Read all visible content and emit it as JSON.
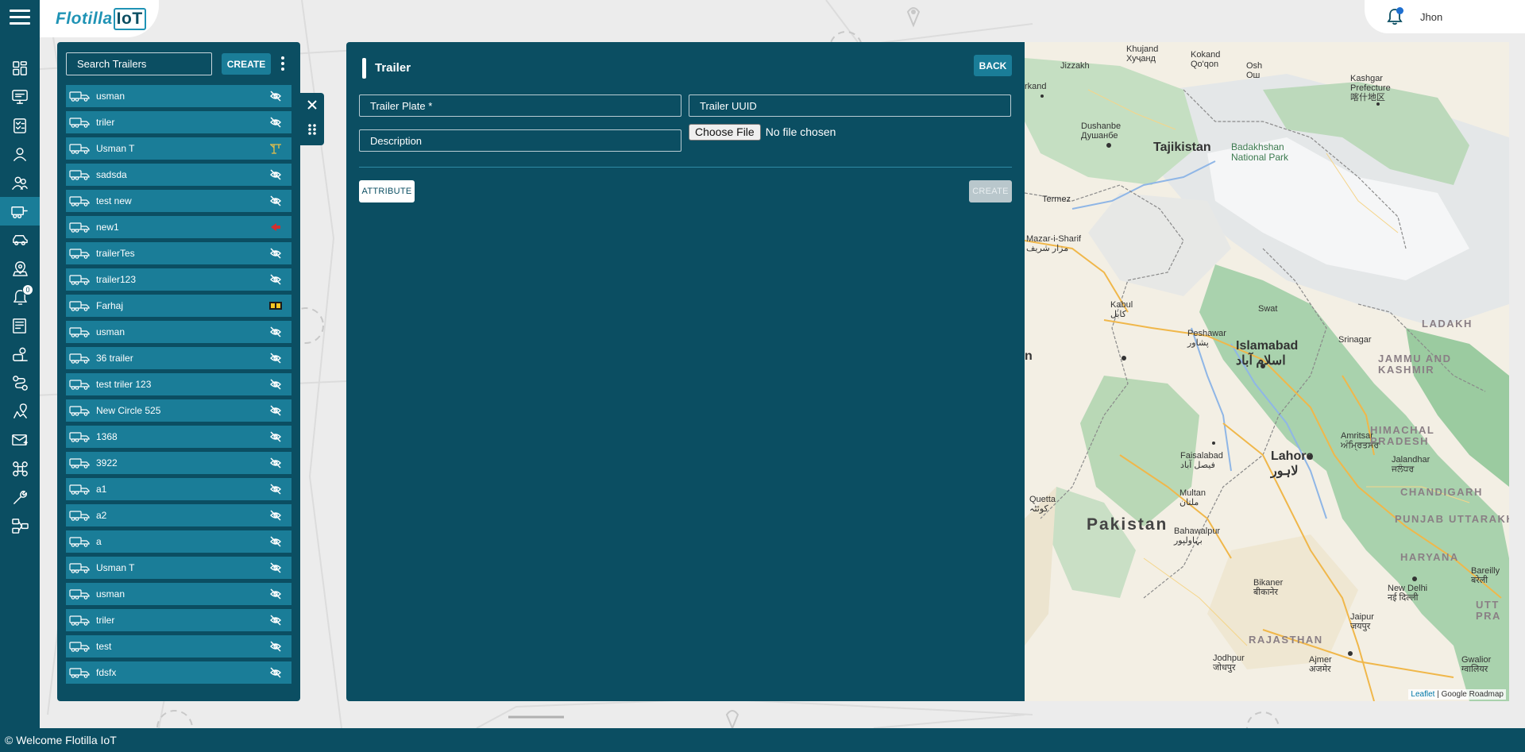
{
  "header": {
    "logo": {
      "text_part": "Flotilla",
      "box_part": "IoT"
    },
    "user": {
      "name": "Jhon"
    }
  },
  "nav": {
    "active_index": 5,
    "notification_count": "0",
    "icons": [
      "dashboard-icon",
      "monitor-icon",
      "checklist-icon",
      "user-icon",
      "users-icon",
      "trailer-icon",
      "car-icon",
      "geofence-icon",
      "bell-icon",
      "report-icon",
      "driver-icon",
      "route-icon",
      "route-pin-icon",
      "mail-icon",
      "command-icon",
      "tools-icon",
      "settings-flow-icon"
    ]
  },
  "trailer_list": {
    "search_placeholder": "Search Trailers",
    "create_label": "CREATE",
    "items": [
      {
        "label": "usman",
        "status": "unlinked"
      },
      {
        "label": "triler",
        "status": "unlinked"
      },
      {
        "label": "Usman T",
        "status": "crane"
      },
      {
        "label": "sadsda",
        "status": "unlinked"
      },
      {
        "label": "test new",
        "status": "unlinked"
      },
      {
        "label": "new1",
        "status": "arrow"
      },
      {
        "label": "trailerTes",
        "status": "unlinked"
      },
      {
        "label": "trailer123",
        "status": "unlinked"
      },
      {
        "label": "Farhaj",
        "status": "flag"
      },
      {
        "label": "usman",
        "status": "unlinked"
      },
      {
        "label": "36 trailer",
        "status": "unlinked"
      },
      {
        "label": "test triler 123",
        "status": "unlinked"
      },
      {
        "label": "New Circle 525",
        "status": "unlinked"
      },
      {
        "label": "1368",
        "status": "unlinked"
      },
      {
        "label": "3922",
        "status": "unlinked"
      },
      {
        "label": "a1",
        "status": "unlinked"
      },
      {
        "label": "a2",
        "status": "unlinked"
      },
      {
        "label": "a",
        "status": "unlinked"
      },
      {
        "label": "Usman T",
        "status": "unlinked"
      },
      {
        "label": "usman",
        "status": "unlinked"
      },
      {
        "label": "triler",
        "status": "unlinked"
      },
      {
        "label": "test",
        "status": "unlinked"
      },
      {
        "label": "fdsfx",
        "status": "unlinked"
      }
    ]
  },
  "form": {
    "title": "Trailer",
    "back_label": "BACK",
    "plate_placeholder": "Trailer Plate *",
    "uuid_placeholder": "Trailer UUID",
    "description_placeholder": "Description",
    "file_button_label": "Choose File",
    "file_status": "No file chosen",
    "attribute_label": "ATTRIBUTE",
    "create_label": "CREATE"
  },
  "map": {
    "labels": {
      "khujand": "Khujand\nХуҷанд",
      "kokand": "Kokand\nQo'qon",
      "osh": "Osh\nОш",
      "jizzakh": "Jizzakh",
      "kashgar": "Kashgar\nPrefecture\n喀什地区",
      "samarkand": "rkand",
      "dushanbe": "Dushanbe\nДушанбе",
      "tajikistan": "Tajikistan",
      "badakhshan": "Badakhshan\nNational Park",
      "termez": "Termez",
      "mazar": "Mazar-i-Sharif\nمزار شریف",
      "kabul": "Kabul\nکابل",
      "swat": "Swat",
      "ladakh": "LADAKH",
      "peshawar": "Peshawar\nپشاور",
      "islamabad": "Islamabad\nاسلام آباد",
      "srinagar": "Srinagar",
      "jammu": "JAMMU AND\nKASHMIR",
      "afghan_edge": "n",
      "amritsar": "Amritsar\nਅੰਮ੍ਰਿਤਸਰ",
      "himachal": "HIMACHAL\nPRADESH",
      "faisalabad": "Faisalabad\nفیصل آباد",
      "lahore": "Lahore\nلاہور",
      "jalandhar": "Jalandhar\nਜਲੰਧਰ",
      "quetta": "Quetta\nکوئٹہ",
      "multan": "Multan\nملتان",
      "chandigarh": "CHANDIGARH",
      "pakistan": "Pakistan",
      "punjab": "PUNJAB",
      "uttarakhand": "UTTARAKHA",
      "bahawalpur": "Bahawalpur\nبہاولپور",
      "haryana": "HARYANA",
      "bareilly": "Bareilly\nबरेली",
      "new_delhi": "New Delhi\nनई दिल्ली",
      "bikaner": "Bikaner\nबीकानेर",
      "utt": "UTT\nPRA",
      "jaipur": "Jaipur\nजयपुर",
      "rajasthan": "RAJASTHAN",
      "jodhpur": "Jodhpur\nजोधपुर",
      "ajmer": "Ajmer\nअजमेर",
      "gwalior": "Gwalior\nग्वालियर"
    },
    "attribution_link": "Leaflet",
    "attribution_text": "| Google Roadmap"
  },
  "footer": {
    "text": "© Welcome Flotilla IoT"
  },
  "colors": {
    "primary": "#0b4e62",
    "accent": "#1a7d98",
    "background": "#ececec"
  }
}
